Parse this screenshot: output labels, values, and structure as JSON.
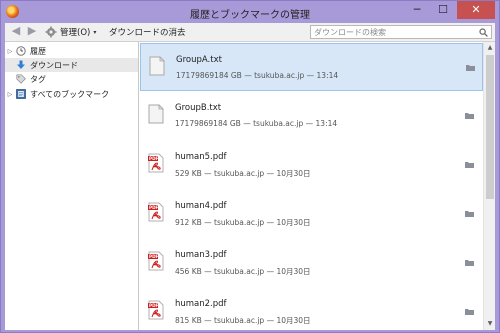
{
  "window": {
    "title": "履歴とブックマークの管理",
    "controls": {
      "minimize": "─",
      "maximize": "☐",
      "close": "✕"
    }
  },
  "toolbar": {
    "back_glyph": "◀",
    "forward_glyph": "▶",
    "manage_label": "管理(O)",
    "manage_chevron": "▾",
    "clear_downloads_label": "ダウンロードの消去",
    "search_placeholder": "ダウンロードの検索"
  },
  "sidebar": {
    "items": [
      {
        "label": "履歴",
        "icon": "clock-icon",
        "twisty": "▷"
      },
      {
        "label": "ダウンロード",
        "icon": "download-arrow-icon",
        "twisty": ""
      },
      {
        "label": "タグ",
        "icon": "tag-icon",
        "twisty": ""
      },
      {
        "label": "すべてのブックマーク",
        "icon": "bookmarks-folder-icon",
        "twisty": "▷"
      }
    ],
    "selected_index": 1
  },
  "downloads": [
    {
      "name": "GroupA.txt",
      "meta": "17179869184 GB — tsukuba.ac.jp — 13:14",
      "type": "text",
      "selected": true
    },
    {
      "name": "GroupB.txt",
      "meta": "17179869184 GB — tsukuba.ac.jp — 13:14",
      "type": "text",
      "selected": false
    },
    {
      "name": "human5.pdf",
      "meta": "529 KB — tsukuba.ac.jp — 10月30日",
      "type": "pdf",
      "selected": false
    },
    {
      "name": "human4.pdf",
      "meta": "912 KB — tsukuba.ac.jp — 10月30日",
      "type": "pdf",
      "selected": false
    },
    {
      "name": "human3.pdf",
      "meta": "456 KB — tsukuba.ac.jp — 10月30日",
      "type": "pdf",
      "selected": false
    },
    {
      "name": "human2.pdf",
      "meta": "815 KB — tsukuba.ac.jp — 10月30日",
      "type": "pdf",
      "selected": false
    }
  ],
  "pdf_badge_label": "PDF",
  "scrollbar": {
    "up_glyph": "▲",
    "down_glyph": "▼"
  },
  "colors": {
    "selection": "#d7e7f8",
    "window_frame": "#a89ad8",
    "pdf_red": "#cc1f1f"
  }
}
